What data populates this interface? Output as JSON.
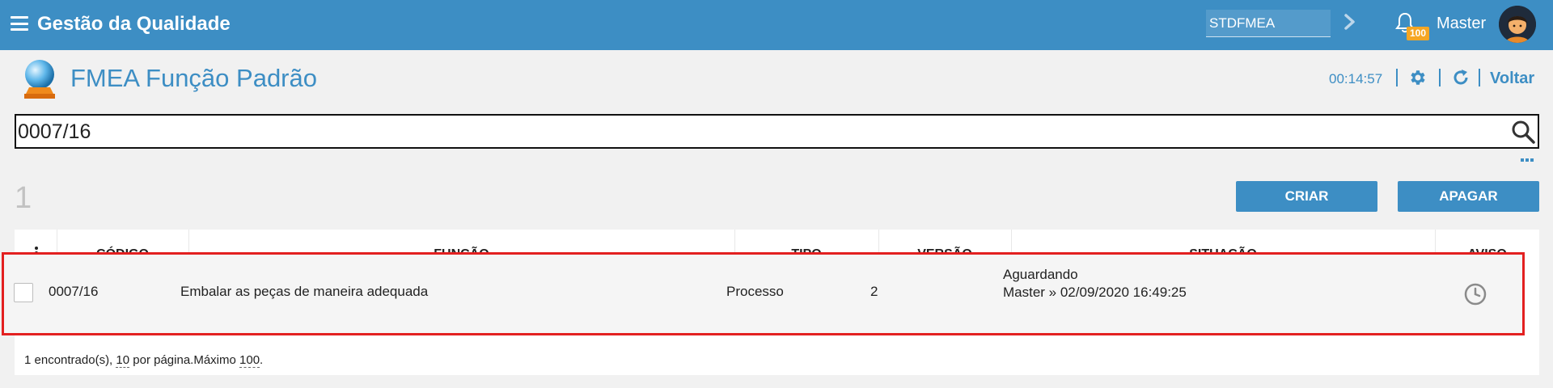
{
  "topbar": {
    "app_title": "Gestão da Qualidade",
    "search_value": "STDFMEA",
    "notification_count": "100",
    "user_name": "Master"
  },
  "page": {
    "title": "FMEA Função Padrão",
    "timer": "00:14:57",
    "back_label": "Voltar"
  },
  "search": {
    "value": "0007/16"
  },
  "results": {
    "count": "1",
    "create_label": "CRIAR",
    "delete_label": "APAGAR"
  },
  "table": {
    "headers": {
      "codigo": "CÓDIGO",
      "funcao": "FUNÇÃO",
      "tipo": "TIPO",
      "versao": "VERSÃO",
      "situacao": "SITUAÇÃO",
      "aviso": "AVISO"
    },
    "rows": [
      {
        "codigo": "0007/16",
        "funcao": "Embalar as peças de maneira adequada",
        "tipo": "Processo",
        "versao": "2",
        "situacao_status": "Aguardando",
        "situacao_detail": "Master » 02/09/2020 16:49:25",
        "aviso_icon": "clock-icon"
      }
    ]
  },
  "footer": {
    "found": "1 encontrado(s),",
    "per_page_value": "10",
    "per_page_label": "por página.Máximo",
    "max_value": "100",
    "end": "."
  },
  "colors": {
    "brand": "#3d8ec4",
    "highlight": "#e32020",
    "badge": "#f5a623"
  }
}
